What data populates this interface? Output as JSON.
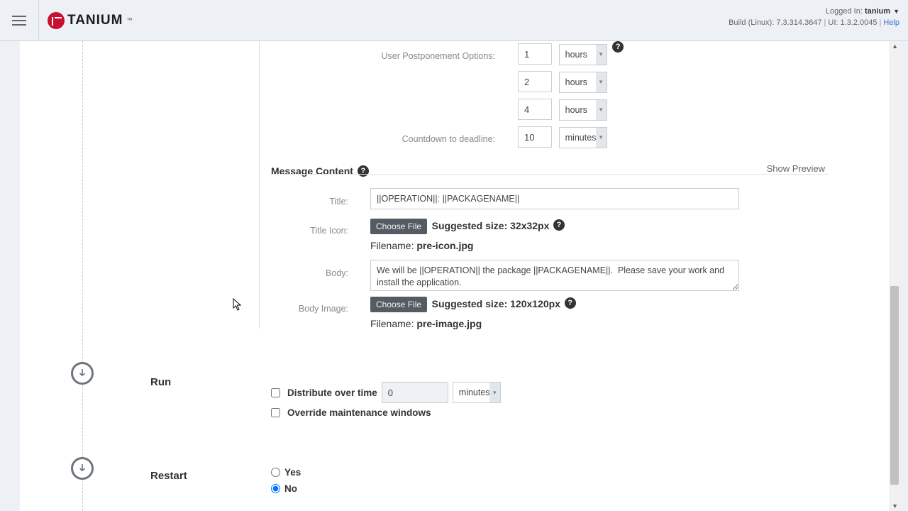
{
  "header": {
    "brand": "TANIUM",
    "logged_in_prefix": "Logged In:",
    "user": "tanium",
    "build_line_left": "Build (Linux): 7.3.314.3647",
    "build_line_right": "UI: 1.3.2.0045",
    "help": "Help"
  },
  "postponement": {
    "label": "User Postponement Options:",
    "rows": [
      {
        "value": "1",
        "unit": "hours"
      },
      {
        "value": "2",
        "unit": "hours"
      },
      {
        "value": "4",
        "unit": "hours"
      }
    ],
    "countdown_label": "Countdown to deadline:",
    "countdown_value": "10",
    "countdown_unit": "minutes"
  },
  "message": {
    "section_title": "Message Content",
    "show_preview": "Show Preview",
    "title_label": "Title:",
    "title_value": "||OPERATION||: ||PACKAGENAME||",
    "title_icon_label": "Title Icon:",
    "choose_file": "Choose File",
    "title_icon_hint": "Suggested size: 32x32px",
    "filename_prefix": "Filename: ",
    "title_icon_filename": "pre-icon.jpg",
    "body_label": "Body:",
    "body_value": "We will be ||OPERATION|| the package ||PACKAGENAME||.  Please save your work and install the application.",
    "body_image_label": "Body Image:",
    "body_image_hint": "Suggested size: 120x120px",
    "body_image_filename": "pre-image.jpg"
  },
  "run": {
    "label": "Run",
    "distribute": "Distribute over time",
    "distribute_value": "0",
    "distribute_unit": "minutes",
    "override": "Override maintenance windows"
  },
  "restart": {
    "label": "Restart",
    "yes": "Yes",
    "no": "No"
  }
}
